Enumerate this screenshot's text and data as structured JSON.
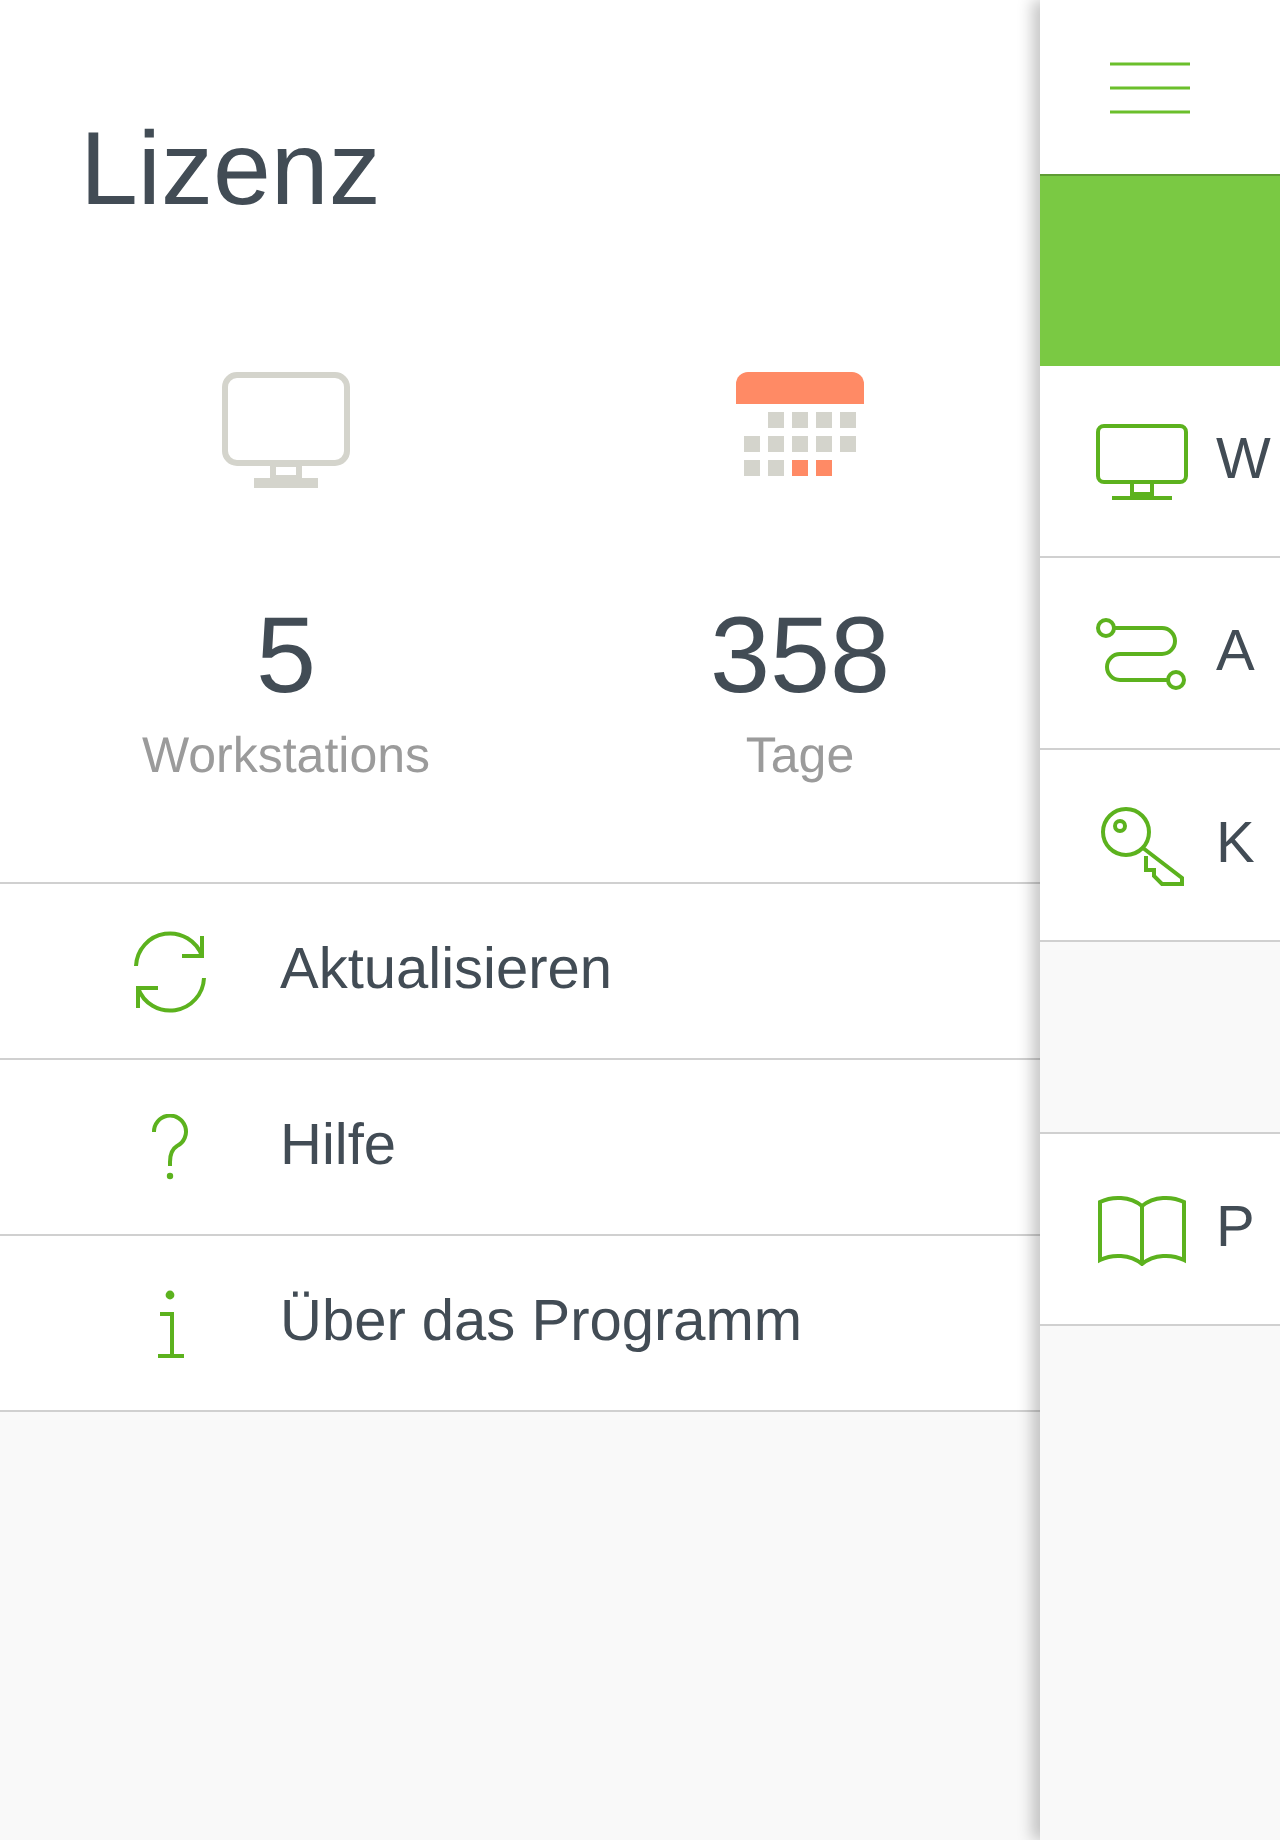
{
  "drawer": {
    "title": "Lizenz",
    "stats": [
      {
        "kind": "workstations",
        "value": "5",
        "label": "Workstations"
      },
      {
        "kind": "days",
        "value": "358",
        "label": "Tage"
      }
    ],
    "menu": [
      {
        "kind": "refresh",
        "label": "Aktualisieren"
      },
      {
        "kind": "help",
        "label": "Hilfe"
      },
      {
        "kind": "info",
        "label": "Über das Programm"
      }
    ]
  },
  "main": {
    "items": [
      {
        "kind": "monitor",
        "label": "W"
      },
      {
        "kind": "route",
        "label": "A"
      },
      {
        "kind": "key",
        "label": "K"
      },
      {
        "kind": "spacer"
      },
      {
        "kind": "book",
        "label": "P"
      }
    ]
  }
}
